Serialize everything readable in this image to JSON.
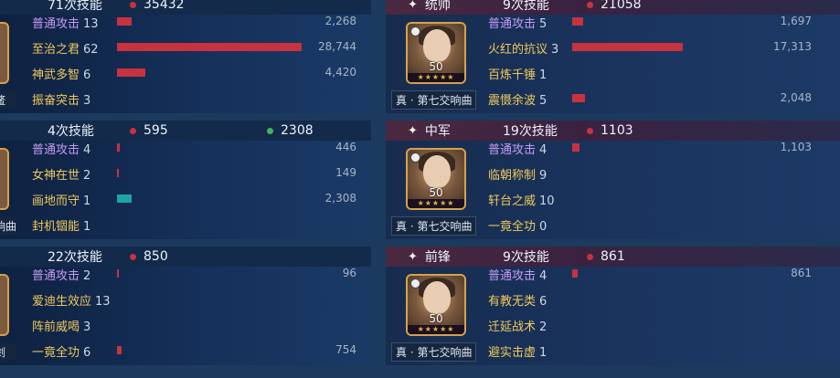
{
  "left_panels": [
    {
      "skill_count": "71次技能",
      "stat_red": "35432",
      "stat_green": "",
      "side_label": "鳌",
      "rows": [
        {
          "name": "普通攻击",
          "count": "13",
          "value": "2,268",
          "bar_ratio": 0.078,
          "bar_color": "#c8323e",
          "kind": "normal"
        },
        {
          "name": "至治之君",
          "count": "62",
          "value": "28,744",
          "bar_ratio": 1.0,
          "bar_color": "#c8323e",
          "kind": "skill"
        },
        {
          "name": "神武多智",
          "count": "6",
          "value": "4,420",
          "bar_ratio": 0.154,
          "bar_color": "#c8323e",
          "kind": "skill"
        },
        {
          "name": "振奋突击",
          "count": "3",
          "value": "",
          "bar_ratio": 0,
          "bar_color": "#c8323e",
          "kind": "skill"
        }
      ]
    },
    {
      "skill_count": "4次技能",
      "stat_red": "595",
      "stat_green": "2308",
      "side_label": "响曲",
      "rows": [
        {
          "name": "普通攻击",
          "count": "4",
          "value": "446",
          "bar_ratio": 0.016,
          "bar_color": "#c8323e",
          "kind": "normal"
        },
        {
          "name": "女神在世",
          "count": "2",
          "value": "149",
          "bar_ratio": 0.006,
          "bar_color": "#c8323e",
          "kind": "skill"
        },
        {
          "name": "画地而守",
          "count": "1",
          "value": "2,308",
          "bar_ratio": 0.08,
          "bar_color": "#1fa4a4",
          "kind": "skill"
        },
        {
          "name": "封机锢能",
          "count": "1",
          "value": "",
          "bar_ratio": 0,
          "bar_color": "#c8323e",
          "kind": "skill"
        }
      ]
    },
    {
      "skill_count": "22次技能",
      "stat_red": "850",
      "stat_green": "",
      "side_label": "剑",
      "rows": [
        {
          "name": "普通攻击",
          "count": "2",
          "value": "96",
          "bar_ratio": 0.004,
          "bar_color": "#c8323e",
          "kind": "normal"
        },
        {
          "name": "爱迪生效应",
          "count": "13",
          "value": "",
          "bar_ratio": 0,
          "bar_color": "#c8323e",
          "kind": "skill"
        },
        {
          "name": "阵前威喝",
          "count": "3",
          "value": "",
          "bar_ratio": 0,
          "bar_color": "#c8323e",
          "kind": "skill"
        },
        {
          "name": "一竟全功",
          "count": "6",
          "value": "754",
          "bar_ratio": 0.026,
          "bar_color": "#c8323e",
          "kind": "skill"
        }
      ]
    }
  ],
  "right_panels": [
    {
      "role": "统帅",
      "skill_count": "9次技能",
      "stat_red": "21058",
      "level": "50",
      "stars": "★★★★★",
      "song": "真 · 第七交响曲",
      "rows": [
        {
          "name": "普通攻击",
          "count": "5",
          "value": "1,697",
          "bar_ratio": 0.098,
          "bar_color": "#c8323e",
          "kind": "normal"
        },
        {
          "name": "火红的抗议",
          "count": "3",
          "value": "17,313",
          "bar_ratio": 1.0,
          "bar_color": "#c8323e",
          "kind": "skill"
        },
        {
          "name": "百炼千锤",
          "count": "1",
          "value": "",
          "bar_ratio": 0,
          "bar_color": "#c8323e",
          "kind": "skill"
        },
        {
          "name": "震慑余波",
          "count": "5",
          "value": "2,048",
          "bar_ratio": 0.118,
          "bar_color": "#c8323e",
          "kind": "skill"
        }
      ]
    },
    {
      "role": "中军",
      "skill_count": "19次技能",
      "stat_red": "1103",
      "level": "50",
      "stars": "★★★★★",
      "song": "真 · 第七交响曲",
      "rows": [
        {
          "name": "普通攻击",
          "count": "4",
          "value": "1,103",
          "bar_ratio": 0.064,
          "bar_color": "#c8323e",
          "kind": "normal"
        },
        {
          "name": "临朝称制",
          "count": "9",
          "value": "",
          "bar_ratio": 0,
          "bar_color": "#c8323e",
          "kind": "skill"
        },
        {
          "name": "轩台之威",
          "count": "10",
          "value": "",
          "bar_ratio": 0,
          "bar_color": "#c8323e",
          "kind": "skill"
        },
        {
          "name": "一竟全功",
          "count": "0",
          "value": "",
          "bar_ratio": 0,
          "bar_color": "#c8323e",
          "kind": "skill"
        }
      ]
    },
    {
      "role": "前锋",
      "skill_count": "9次技能",
      "stat_red": "861",
      "level": "50",
      "stars": "★★★★★",
      "song": "真 · 第七交响曲",
      "rows": [
        {
          "name": "普通攻击",
          "count": "4",
          "value": "861",
          "bar_ratio": 0.05,
          "bar_color": "#c8323e",
          "kind": "normal"
        },
        {
          "name": "有教无类",
          "count": "6",
          "value": "",
          "bar_ratio": 0,
          "bar_color": "#c8323e",
          "kind": "skill"
        },
        {
          "name": "迁延战术",
          "count": "2",
          "value": "",
          "bar_ratio": 0,
          "bar_color": "#c8323e",
          "kind": "skill"
        },
        {
          "name": "避实击虚",
          "count": "1",
          "value": "",
          "bar_ratio": 0,
          "bar_color": "#c8323e",
          "kind": "skill"
        }
      ]
    }
  ],
  "icons": {
    "role": "sparkle-icon",
    "stat": "dot-icon",
    "portrait_badge": "weather-icon"
  }
}
